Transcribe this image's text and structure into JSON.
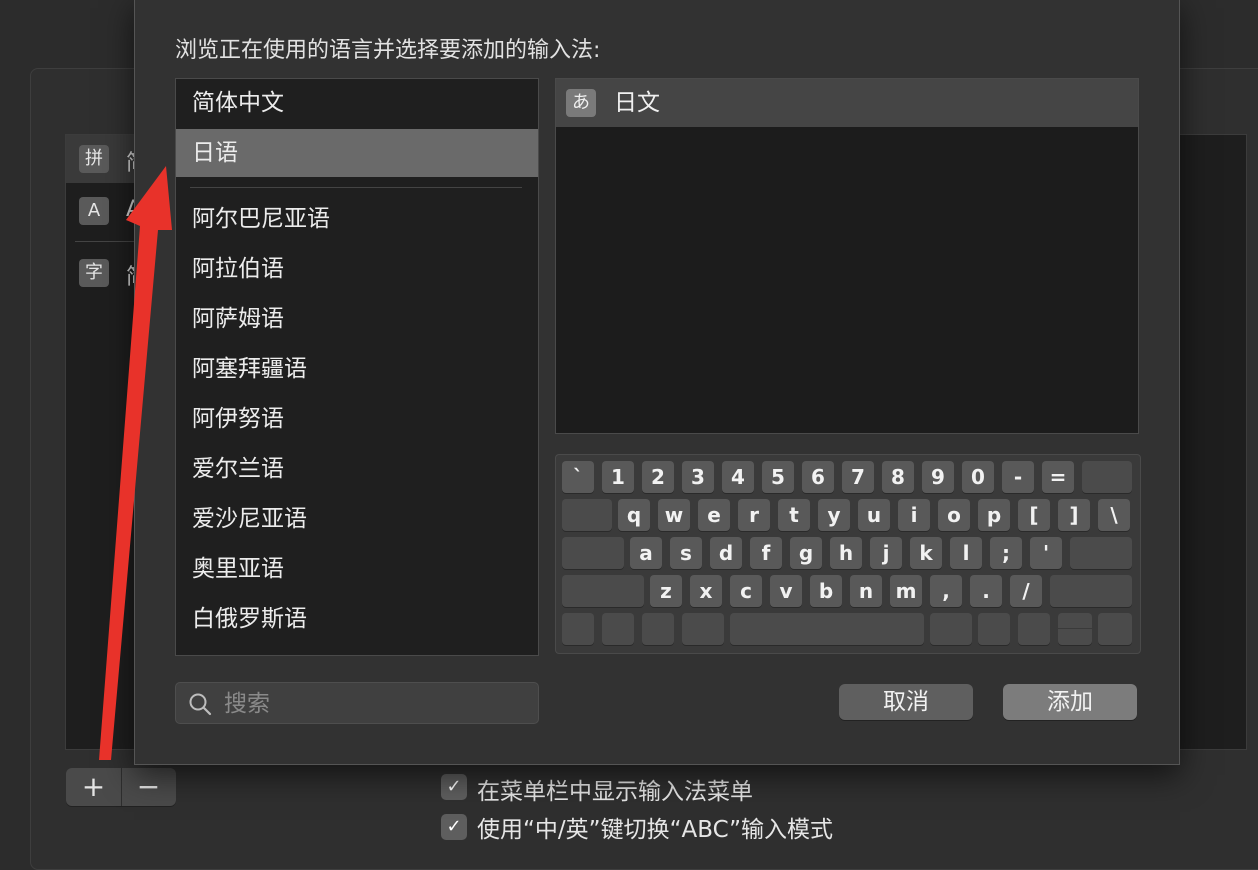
{
  "background": {
    "enabled_methods": [
      {
        "icon": "拼",
        "label": "简"
      },
      {
        "icon": "A",
        "label": "A"
      },
      {
        "icon": "字",
        "label": "简"
      }
    ],
    "plus_label": "+",
    "minus_label": "−",
    "options": [
      {
        "checked": true,
        "label": "在菜单栏中显示输入法菜单"
      },
      {
        "checked": true,
        "label": "使用“中/英”键切换“ABC”输入模式"
      }
    ]
  },
  "dialog": {
    "prompt": "浏览正在使用的语言并选择要添加的输入法:",
    "languages_top": [
      "简体中文",
      "日语"
    ],
    "languages": [
      "阿尔巴尼亚语",
      "阿拉伯语",
      "阿萨姆语",
      "阿塞拜疆语",
      "阿伊努语",
      "爱尔兰语",
      "爱沙尼亚语",
      "奥里亚语",
      "白俄罗斯语"
    ],
    "selected_language": "日语",
    "input_methods": [
      {
        "icon": "あ",
        "label": "日文",
        "selected": true
      }
    ],
    "keyboard_rows": [
      [
        "`",
        "1",
        "2",
        "3",
        "4",
        "5",
        "6",
        "7",
        "8",
        "9",
        "0",
        "-",
        "="
      ],
      [
        "q",
        "w",
        "e",
        "r",
        "t",
        "y",
        "u",
        "i",
        "o",
        "p",
        "[",
        "]",
        "\\"
      ],
      [
        "a",
        "s",
        "d",
        "f",
        "g",
        "h",
        "j",
        "k",
        "l",
        ";",
        "'"
      ],
      [
        "z",
        "x",
        "c",
        "v",
        "b",
        "n",
        "m",
        ",",
        ".",
        "/"
      ]
    ],
    "search": {
      "placeholder": "搜索",
      "value": ""
    },
    "cancel_label": "取消",
    "add_label": "添加"
  },
  "colors": {
    "annotation_arrow": "#e8322a",
    "selected_row": "#6a6a6a"
  }
}
